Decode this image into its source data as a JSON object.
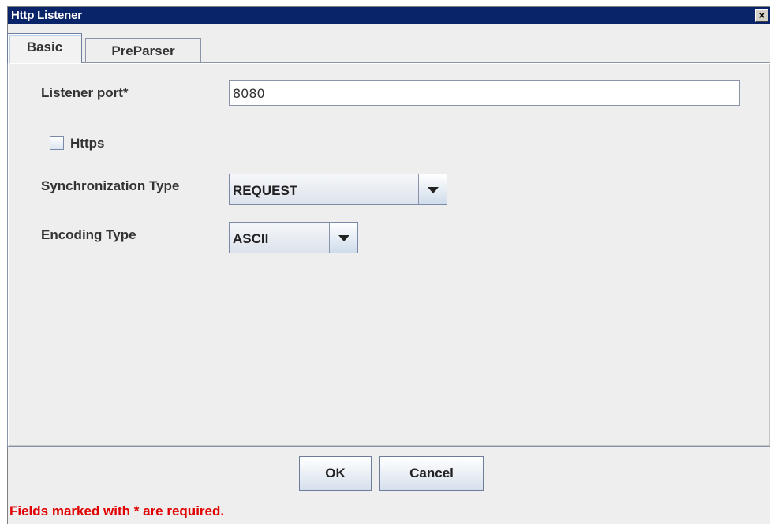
{
  "window": {
    "title": "Http Listener",
    "close_symbol": "✕"
  },
  "tabs": [
    {
      "label": "Basic",
      "selected": true
    },
    {
      "label": "PreParser",
      "selected": false
    }
  ],
  "form": {
    "listener_port": {
      "label": "Listener port*",
      "value": "8080"
    },
    "https": {
      "label": "Https",
      "checked": false
    },
    "synchronization_type": {
      "label": "Synchronization Type",
      "value": "REQUEST"
    },
    "encoding_type": {
      "label": "Encoding Type",
      "value": "ASCII"
    }
  },
  "buttons": {
    "ok": "OK",
    "cancel": "Cancel"
  },
  "footer": {
    "required_note": "Fields marked with * are required."
  },
  "colors": {
    "titlebar": "#0a246a",
    "required_text": "#e00000"
  }
}
